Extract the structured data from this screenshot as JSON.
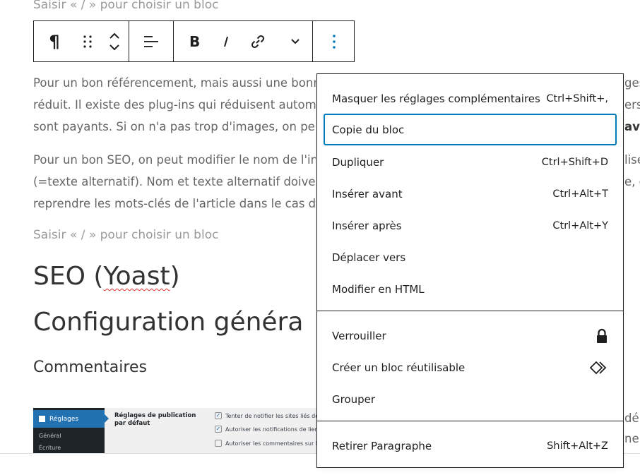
{
  "editor": {
    "placeholder_top": "Saisir « / » pour choisir un bloc",
    "para1_lines": [
      "Pour un bon référencement, mais aussi une bonne",
      "réduit. Il existe des plug-ins qui réduisent automa",
      "sont payants. Si on n'a pas trop d'images, on peut"
    ],
    "para1_right": [
      "ges",
      "erse",
      "ava"
    ],
    "para2_lines": [
      "Pour un bon SEO, on peut modifier le nom de l'im",
      "(=texte alternatif). Nom et texte alternatif doivent",
      "reprendre les mots-clés de l'article dans le cas d'u"
    ],
    "para2_right": [
      "lise",
      "e, c"
    ],
    "placeholder_mid": "Saisir « / » pour choisir un bloc",
    "heading_seo_prefix": "SEO (",
    "heading_seo_word": "Yoast",
    "heading_seo_suffix": ")",
    "heading_config": "Configuration généra",
    "heading_comments": "Commentaires",
    "bottom_right": [
      "dé",
      "ner"
    ]
  },
  "toolbar": {
    "paragraph_icon": "¶"
  },
  "thumbnail": {
    "menu_active": "Réglages",
    "menu_sub": [
      "Général",
      "Écriture"
    ],
    "section_title": "Réglages de publication par défaut",
    "options": [
      {
        "label": "Tenter de notifier les sites liés de",
        "checked": true
      },
      {
        "label": "Autoriser les notifications de lien",
        "checked": true
      },
      {
        "label": "Autoriser les commentaires sur le",
        "checked": false
      }
    ],
    "check_glyph": "✓"
  },
  "menu": {
    "group1": [
      {
        "label": "Masquer les réglages complémentaires",
        "shortcut": "Ctrl+Shift+,"
      },
      {
        "label": "Copie du bloc",
        "shortcut": ""
      },
      {
        "label": "Dupliquer",
        "shortcut": "Ctrl+Shift+D"
      },
      {
        "label": "Insérer avant",
        "shortcut": "Ctrl+Alt+T"
      },
      {
        "label": "Insérer après",
        "shortcut": "Ctrl+Alt+Y"
      },
      {
        "label": "Déplacer vers",
        "shortcut": ""
      },
      {
        "label": "Modifier en HTML",
        "shortcut": ""
      }
    ],
    "group2": [
      {
        "label": "Verrouiller",
        "icon": "lock-icon"
      },
      {
        "label": "Créer un bloc réutilisable",
        "icon": "reusable-block-icon"
      },
      {
        "label": "Grouper",
        "icon": ""
      }
    ],
    "group3": [
      {
        "label": "Retirer Paragraphe",
        "shortcut": "Shift+Alt+Z"
      }
    ],
    "focus_color": "#007cba"
  }
}
